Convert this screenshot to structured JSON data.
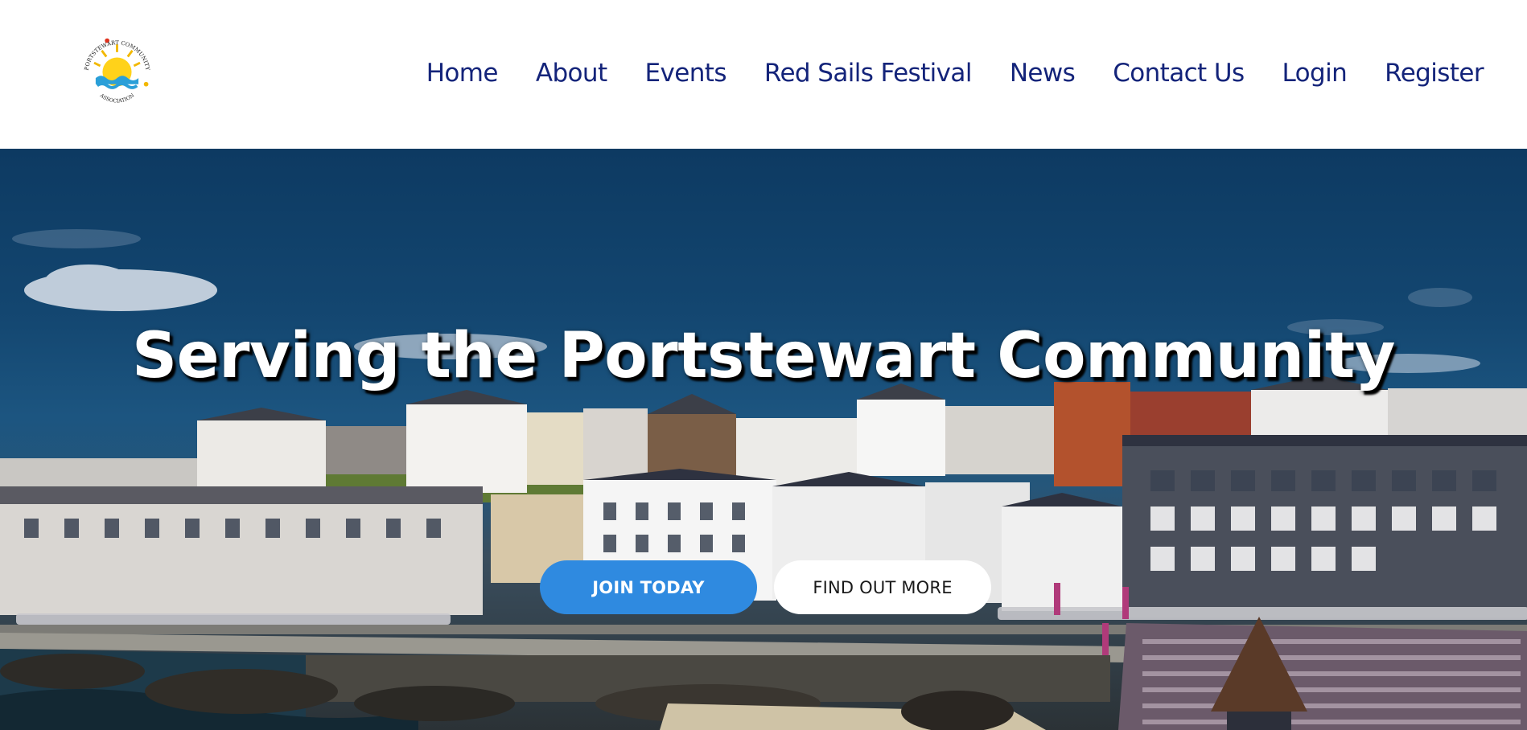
{
  "site": {
    "logo": {
      "name": "portstewart-community-association-logo",
      "text_top": "PORTSTEWART COMMUNITY",
      "text_bottom": "ASSOCIATION"
    }
  },
  "nav": {
    "items": [
      {
        "label": "Home"
      },
      {
        "label": "About"
      },
      {
        "label": "Events"
      },
      {
        "label": "Red Sails Festival"
      },
      {
        "label": "News"
      },
      {
        "label": "Contact Us"
      },
      {
        "label": "Login"
      },
      {
        "label": "Register"
      }
    ]
  },
  "hero": {
    "title": "Serving the Portstewart Community",
    "join_label": "JOIN TODAY",
    "more_label": "FIND OUT MORE"
  },
  "colors": {
    "nav_text": "#14247a",
    "primary_button": "#2f8ae0",
    "secondary_button": "#ffffff"
  }
}
